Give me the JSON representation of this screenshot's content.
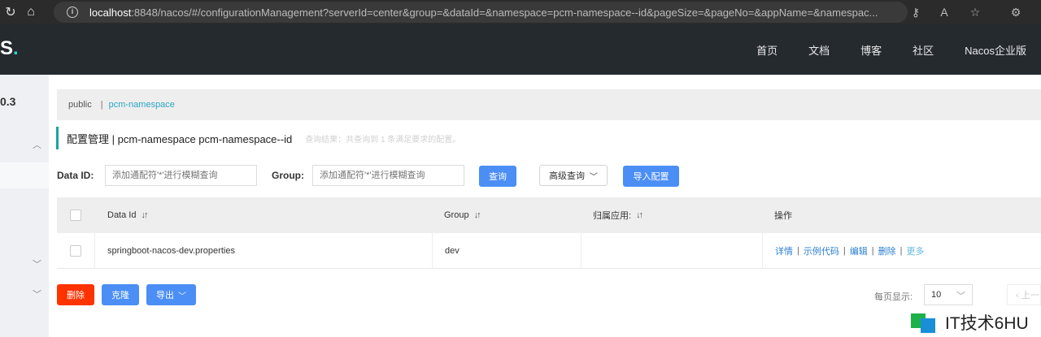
{
  "browser": {
    "url_host": "localhost",
    "url_rest": ":8848/nacos/#/configurationManagement?serverId=center&group=&dataId=&namespace=pcm-namespace--id&pageSize=&pageNo=&appName=&namespac..."
  },
  "header": {
    "logo_text": "S",
    "logo_dot": ".",
    "nav": [
      "首页",
      "文档",
      "博客",
      "社区",
      "Nacos企业版"
    ]
  },
  "sidebar": {
    "version": "0.3"
  },
  "namespace_bar": {
    "public": "public",
    "separator": "|",
    "current": "pcm-namespace"
  },
  "title": {
    "text": "配置管理  |  pcm-namespace  pcm-namespace--id",
    "hint": "查询结果：共查询到 1 条满足要求的配置。"
  },
  "search": {
    "dataid_label": "Data ID:",
    "dataid_placeholder": "添加通配符'*'进行模糊查询",
    "group_label": "Group:",
    "group_placeholder": "添加通配符'*'进行模糊查询",
    "query_btn": "查询",
    "advanced_btn": "高级查询",
    "import_btn": "导入配置"
  },
  "table": {
    "headers": {
      "dataid": "Data Id",
      "group": "Group",
      "app": "归属应用:",
      "ops": "操作"
    },
    "rows": [
      {
        "dataid": "springboot-nacos-dev.properties",
        "group": "dev",
        "app": ""
      }
    ],
    "ops": {
      "detail": "详情",
      "sample": "示例代码",
      "edit": "编辑",
      "delete": "删除",
      "more": "更多"
    }
  },
  "bottom": {
    "delete_btn": "删除",
    "clone_btn": "克隆",
    "export_btn": "导出",
    "page_size_label": "每页显示:",
    "page_size": "10",
    "prev": "‹ 上一"
  },
  "watermark": {
    "text": "IT技术6HU"
  },
  "colors": {
    "accent": "#1aa3a0",
    "primary": "#4b8ef5",
    "danger": "#ff3300",
    "header_bg": "#252a2f"
  }
}
